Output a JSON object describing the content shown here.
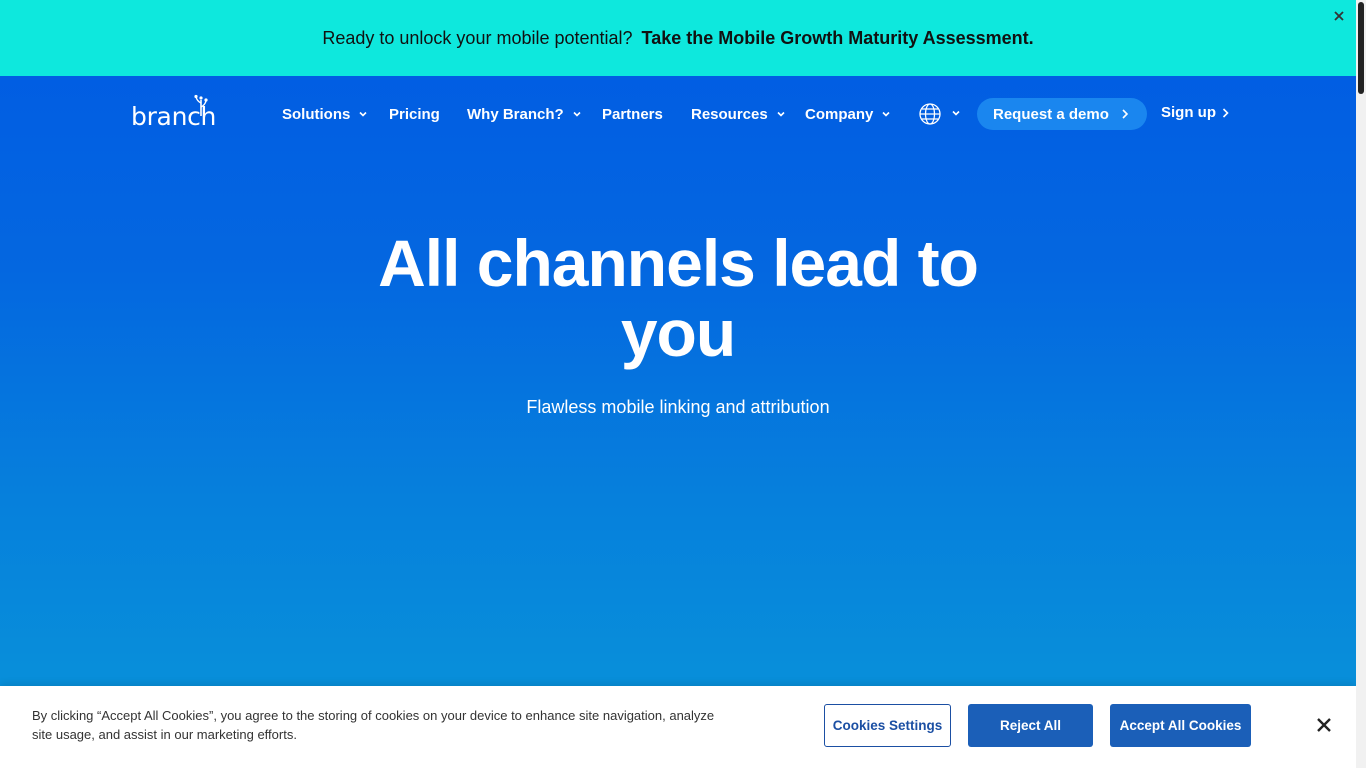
{
  "announcement": {
    "text": "Ready to unlock your mobile potential?",
    "link_text": "Take the Mobile Growth Maturity Assessment."
  },
  "nav": {
    "logo_text": "branch",
    "items": [
      {
        "label": "Solutions",
        "has_dropdown": true
      },
      {
        "label": "Pricing",
        "has_dropdown": false
      },
      {
        "label": "Why Branch?",
        "has_dropdown": true
      },
      {
        "label": "Partners",
        "has_dropdown": false
      },
      {
        "label": "Resources",
        "has_dropdown": true
      },
      {
        "label": "Company",
        "has_dropdown": true
      }
    ],
    "demo_label": "Request a demo",
    "signup_label": "Sign up"
  },
  "hero": {
    "title": "All channels lead to you",
    "subtitle": "Flawless mobile linking and attribution"
  },
  "cookie_banner": {
    "text": "By clicking “Accept All Cookies”, you agree to the storing of cookies on your device to enhance site navigation, analyze site usage, and assist in our marketing efforts.",
    "settings_label": "Cookies Settings",
    "reject_label": "Reject All",
    "accept_label": "Accept All Cookies"
  },
  "colors": {
    "announcement_bg": "#0ee8dd",
    "hero_top": "#005ae4",
    "hero_bottom": "#0996d9",
    "demo_button": "#1a86ef",
    "cookie_button": "#1b5fb8"
  },
  "icons": {
    "nav_dropdown": "chevron-down-icon",
    "language": "globe-icon",
    "demo_arrow": "chevron-right-icon",
    "close": "close-icon"
  }
}
